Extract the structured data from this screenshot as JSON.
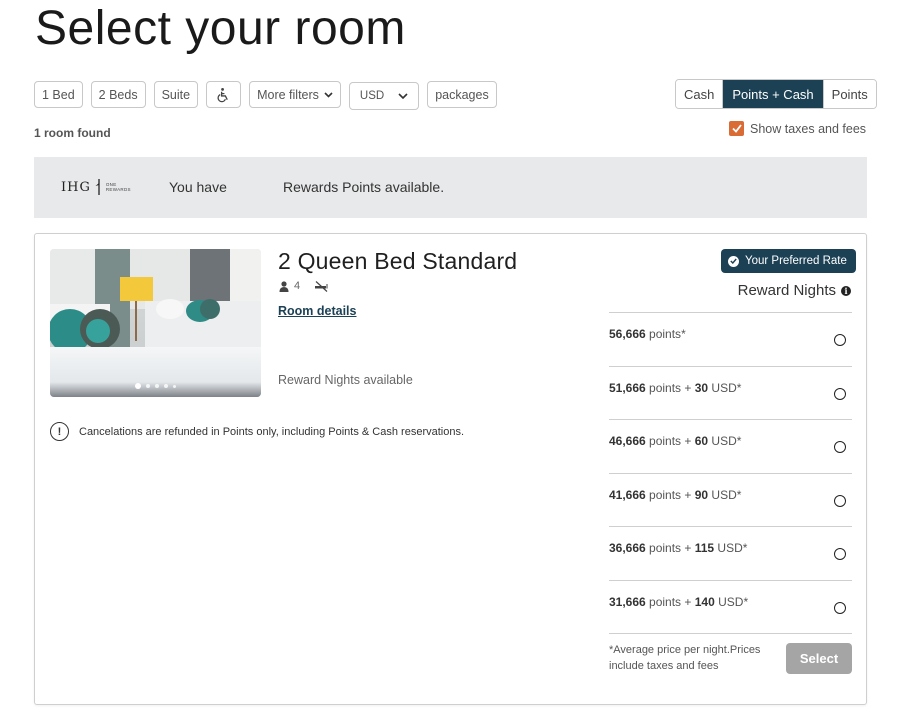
{
  "page": {
    "title": "Select your room"
  },
  "filters": {
    "one_bed": "1 Bed",
    "two_beds": "2 Beds",
    "suite": "Suite",
    "accessible_icon": "wheelchair-icon",
    "more_filters": "More filters",
    "currency": "USD",
    "packages": "packages"
  },
  "rate_toggle": {
    "options": [
      "Cash",
      "Points + Cash",
      "Points"
    ],
    "selected": "Points + Cash"
  },
  "results": {
    "count_label": "1 room found"
  },
  "taxes_toggle": {
    "label": "Show taxes and fees",
    "checked": true,
    "color": "#d96b35"
  },
  "rewards_banner": {
    "logo_text": "IHG",
    "logo_sub_1": "ONE",
    "logo_sub_2": "REWARDS",
    "you_have": "You have",
    "points_available": "Rewards Points available."
  },
  "room": {
    "name": "2 Queen Bed Standard",
    "guests": "4",
    "non_smoking_icon": "no-smoking-icon",
    "details_link": "Room details",
    "availability": "Reward Nights available",
    "photo_count": 5,
    "photo_active": 1,
    "cancel_note": "Cancelations are refunded in Points only, including Points & Cash reservations.",
    "preferred_badge": "Your Preferred Rate",
    "rate_type": "Reward Nights",
    "rates": [
      {
        "points": "56,666",
        "points_label": " points",
        "plus": "",
        "cash": "",
        "currency": "",
        "suffix": "*"
      },
      {
        "points": "51,666",
        "points_label": " points + ",
        "plus": "",
        "cash": "30",
        "currency": " USD",
        "suffix": "*"
      },
      {
        "points": "46,666",
        "points_label": " points + ",
        "plus": "",
        "cash": "60",
        "currency": " USD",
        "suffix": "*"
      },
      {
        "points": "41,666",
        "points_label": " points + ",
        "plus": "",
        "cash": "90",
        "currency": " USD",
        "suffix": "*"
      },
      {
        "points": "36,666",
        "points_label": " points + ",
        "plus": "",
        "cash": "115",
        "currency": " USD",
        "suffix": "*"
      },
      {
        "points": "31,666",
        "points_label": " points + ",
        "plus": "",
        "cash": "140",
        "currency": " USD",
        "suffix": "*"
      }
    ],
    "footnote": "*Average price per night.Prices include taxes and fees",
    "select_label": "Select"
  },
  "colors": {
    "brand_dark": "#1c4155",
    "accent_orange": "#d96b35",
    "banner_bg": "#e8e9ea",
    "disabled_button": "#a5a5a5"
  }
}
